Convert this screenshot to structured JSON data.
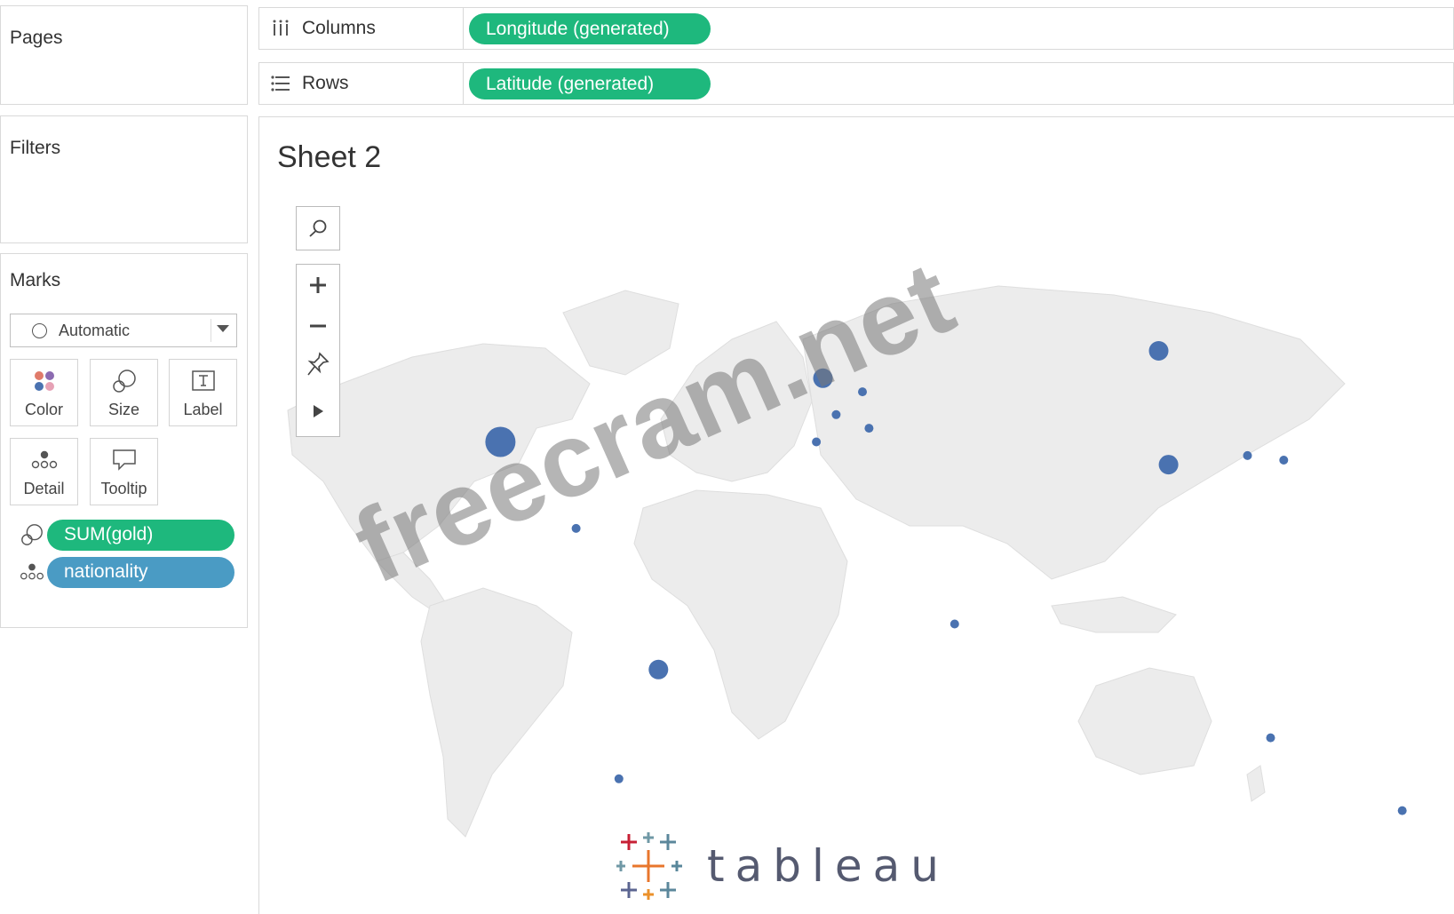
{
  "pages": {
    "title": "Pages"
  },
  "filters": {
    "title": "Filters"
  },
  "marks": {
    "title": "Marks",
    "mark_type": "Automatic",
    "buttons": [
      {
        "label": "Color",
        "icon": "color-icon"
      },
      {
        "label": "Size",
        "icon": "size-icon"
      },
      {
        "label": "Label",
        "icon": "label-icon"
      },
      {
        "label": "Detail",
        "icon": "detail-icon"
      },
      {
        "label": "Tooltip",
        "icon": "tooltip-icon"
      }
    ],
    "pills": [
      {
        "label": "SUM(gold)",
        "icon": "size-icon",
        "color": "#1eb87d"
      },
      {
        "label": "nationality",
        "icon": "detail-icon",
        "color": "#4a9bc4"
      }
    ]
  },
  "shelves": {
    "columns": {
      "label": "Columns",
      "pill": "Longitude (generated)",
      "icon": "columns-icon"
    },
    "rows": {
      "label": "Rows",
      "pill": "Latitude (generated)",
      "icon": "rows-icon"
    }
  },
  "sheet": {
    "title": "Sheet 2"
  },
  "map_controls": [
    "search-icon",
    "zoom-in-icon",
    "zoom-out-icon",
    "pin-icon",
    "play-arrow-icon"
  ],
  "watermark": "freecram.net",
  "logo": {
    "text": "tableau"
  },
  "colors": {
    "mark": "#4a72b0",
    "pill_green": "#1eb87d",
    "pill_blue": "#4a9bc4",
    "land": "#ececec"
  },
  "chart_data": {
    "type": "scatter",
    "marks": [
      {
        "lon": -100,
        "lat": 40,
        "size": "large"
      },
      {
        "lon": 100,
        "lat": 60,
        "size": "medium"
      },
      {
        "lon": 103,
        "lat": 35,
        "size": "medium"
      },
      {
        "lon": -2,
        "lat": 54,
        "size": "medium"
      },
      {
        "lon": -52,
        "lat": -10,
        "size": "medium"
      },
      {
        "lon": 134,
        "lat": -25,
        "size": "small"
      },
      {
        "lon": -64,
        "lat": -34,
        "size": "small"
      },
      {
        "lon": 138,
        "lat": 36,
        "size": "small"
      },
      {
        "lon": 127,
        "lat": 37,
        "size": "small"
      },
      {
        "lon": 2,
        "lat": 46,
        "size": "small"
      },
      {
        "lon": 10,
        "lat": 51,
        "size": "small"
      },
      {
        "lon": 12,
        "lat": 43,
        "size": "small"
      },
      {
        "lon": -4,
        "lat": 40,
        "size": "small"
      },
      {
        "lon": -77,
        "lat": 21,
        "size": "small"
      },
      {
        "lon": 38,
        "lat": 0,
        "size": "small"
      },
      {
        "lon": 174,
        "lat": -41,
        "size": "small"
      }
    ]
  }
}
